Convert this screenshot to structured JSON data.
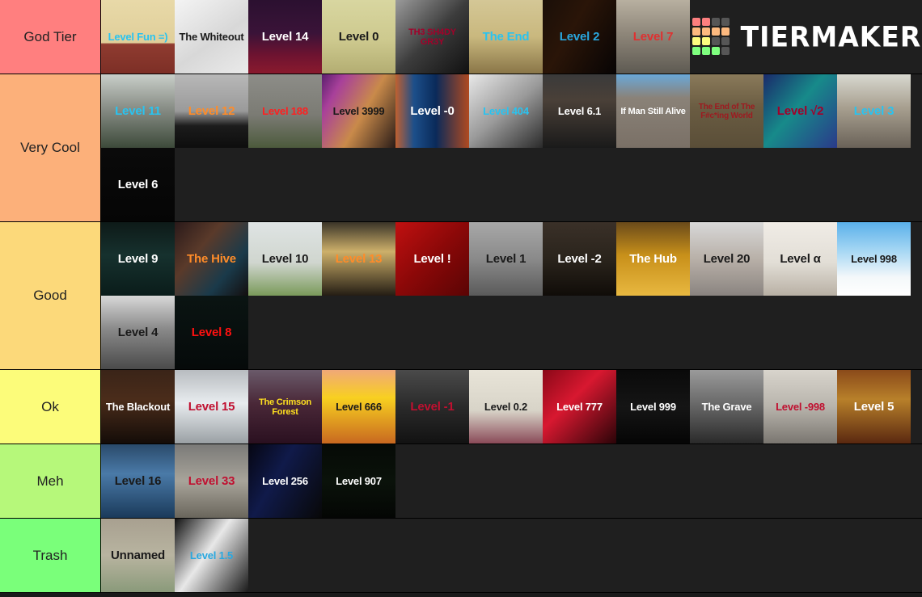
{
  "brand": {
    "name": "TIERMAKER",
    "logo_colors": [
      "#fc7f7f",
      "#fc7f7f",
      "#565656",
      "#565656",
      "#fcb97f",
      "#fcb97f",
      "#fcb97f",
      "#fcb97f",
      "#fcfc7f",
      "#fcfc7f",
      "#565656",
      "#565656",
      "#7fff7f",
      "#7fff7f",
      "#7fff7f",
      "#565656"
    ]
  },
  "tiers": [
    {
      "label": "God Tier",
      "color": "#ff7f7f",
      "items": [
        {
          "label": "Level Fun =)",
          "text_color": "#29c3f0",
          "bg": "linear-gradient(#e8d9a8 0%,#e0cf9a 58%,#8f3b30 60%,#7d2f26 100%)"
        },
        {
          "label": "The Whiteout",
          "text_color": "#1a1a1a",
          "bg": "linear-gradient(145deg,#f4f4f4,#d8d8d8 55%,#eaeaea)"
        },
        {
          "label": "Level 14",
          "text_color": "#ffffff",
          "bg": "linear-gradient(#2b1030 0%,#3a1338 45%,#6e1330 75%,#8a1a2e 100%)"
        },
        {
          "label": "Level 0",
          "text_color": "#1a1a1a",
          "bg": "linear-gradient(#d8d6a0 0%,#cdc98e 55%,#b3ad72 100%)"
        },
        {
          "label": "TH3 SH4DY GR3Y",
          "text_color": "#a3002a",
          "bg": "linear-gradient(135deg,#9a9a9a,#3c3c3c 50%,#111 100%)"
        },
        {
          "label": "The End",
          "text_color": "#29c3f0",
          "bg": "linear-gradient(#d4c796 0%,#c9b87e 50%,#8a7648 100%)"
        },
        {
          "label": "Level 2",
          "text_color": "#29a8e0",
          "bg": "linear-gradient(120deg,#1a0f08,#2a1508 40%,#070404 100%)"
        },
        {
          "label": "Level 7",
          "text_color": "#e03030",
          "bg": "linear-gradient(#b8b0a0 0%,#8f877a 45%,#5e5a52 100%)"
        }
      ]
    },
    {
      "label": "Very Cool",
      "color": "#fcb07a",
      "items": [
        {
          "label": "Level 11",
          "text_color": "#29c3f0",
          "bg": "linear-gradient(#c9cfc9 0%,#8a8f88 45%,#3d4a3a 100%)"
        },
        {
          "label": "Level 12",
          "text_color": "#ff8c29",
          "bg": "linear-gradient(#b8b8b8 0%,#9a9a9a 50%,#1c1c1c 70%,#0d0d0d 100%)"
        },
        {
          "label": "Level 188",
          "text_color": "#ff2020",
          "bg": "linear-gradient(#8d8d88 0%,#7b7b74 55%,#4c5a3c 100%)"
        },
        {
          "label": "Level 3999",
          "text_color": "#1a1a1a",
          "bg": "linear-gradient(120deg,#5b1f6e,#a8409a 20%,#c98a4a 55%,#2a1c18 100%)"
        },
        {
          "label": "Level -0",
          "text_color": "#ffffff",
          "bg": "linear-gradient(90deg,#c06030,#1c4f8a 25%,#0a2a5a 55%,#b04a20 100%)"
        },
        {
          "label": "Level 404",
          "text_color": "#29c3f0",
          "bg": "linear-gradient(140deg,#e8e8e8,#9a9a9a 50%,#2a2a2a)"
        },
        {
          "label": "Level 6.1",
          "text_color": "#ffffff",
          "bg": "linear-gradient(#3a3a3a 0%,#4a4038 35%,#1a1a1a 100%)"
        },
        {
          "label": "If Man Still Alive",
          "text_color": "#ffffff",
          "bg": "linear-gradient(#6aa8d8 0%,#8a8278 32%,#7a7066 100%)"
        },
        {
          "label": "The End of The F#c*ing World",
          "text_color": "#9e1a20",
          "bg": "linear-gradient(#8a7a5a 0%,#6a5c42 45%,#5a4e38 100%)"
        },
        {
          "label": "Level √2",
          "text_color": "#a3002a",
          "bg": "linear-gradient(130deg,#1a2a6a,#178a8a 45%,#2a3a8a 100%)"
        },
        {
          "label": "Level 3",
          "text_color": "#29c3f0",
          "bg": "linear-gradient(#d8d8d0 0%,#a8a090 45%,#6a6258 100%)"
        },
        {
          "label": "Level 6",
          "text_color": "#ffffff",
          "bg": "linear-gradient(#0a0a0a,#050505)"
        }
      ]
    },
    {
      "label": "Good",
      "color": "#fcd97a",
      "items": [
        {
          "label": "Level 9",
          "text_color": "#ffffff",
          "bg": "linear-gradient(#0e1a18 0%,#16312e 45%,#0a1c1a 100%)"
        },
        {
          "label": "The Hive",
          "text_color": "#ff8c29",
          "bg": "linear-gradient(130deg,#2a1a1a,#5a3a2a 35%,#1a3a4a 70%,#140e0e)"
        },
        {
          "label": "Level 10",
          "text_color": "#1a1a1a",
          "bg": "linear-gradient(#dfe4e4 0%,#d0d6cf 55%,#7a9a5a 100%)"
        },
        {
          "label": "Level 13",
          "text_color": "#ff8c29",
          "bg": "linear-gradient(#3a3428 0%,#cdb06a 40%,#241d14 100%)"
        },
        {
          "label": "Level !",
          "text_color": "#ffffff",
          "bg": "linear-gradient(135deg,#c01010,#8a0808 50%,#5a0404)"
        },
        {
          "label": "Level 1",
          "text_color": "#1a1a1a",
          "bg": "linear-gradient(#a8a8a8 0%,#8a8a8a 50%,#5a5a5a 100%)"
        },
        {
          "label": "Level -2",
          "text_color": "#ffffff",
          "bg": "linear-gradient(#3a3028 0%,#2a241c 50%,#100c08 100%)"
        },
        {
          "label": "The Hub",
          "text_color": "#ffffff",
          "bg": "linear-gradient(#6a4a1a 0%,#c8901a 45%,#e8b840 100%)"
        },
        {
          "label": "Level 20",
          "text_color": "#1a1a1a",
          "bg": "linear-gradient(#d8d8d8 0%,#b8b0a8 50%,#8a8480 100%)"
        },
        {
          "label": "Level α",
          "text_color": "#1a1a1a",
          "bg": "linear-gradient(#f0ece6 0%,#e2ded6 55%,#b8b0a4 100%)"
        },
        {
          "label": "Level 998",
          "text_color": "#1a1a1a",
          "bg": "linear-gradient(#5ab0ea 0%,#a8d8f4 40%,#f4f8fa 75%,#ffffff 100%)"
        },
        {
          "label": "Level 4",
          "text_color": "#1a1a1a",
          "bg": "linear-gradient(#d8d8d8 0%,#8a8a8a 45%,#4a4a4a 100%)"
        },
        {
          "label": "Level 8",
          "text_color": "#ff1010",
          "bg": "linear-gradient(#0a1412,#060a0a)"
        }
      ]
    },
    {
      "label": "Ok",
      "color": "#fcfc7a",
      "items": [
        {
          "label": "The Blackout",
          "text_color": "#ffffff",
          "bg": "linear-gradient(#3a2418 0%,#4a2c1a 40%,#140c08 100%)"
        },
        {
          "label": "Level 15",
          "text_color": "#c01030",
          "bg": "linear-gradient(#b8bcc0 0%,#e8ecef 45%,#9aa0a4 100%)"
        },
        {
          "label": "The Crimson Forest",
          "text_color": "#ffe020",
          "bg": "linear-gradient(#6a5a6a 0%,#4a2838 45%,#2a1020 100%)"
        },
        {
          "label": "Level 666",
          "text_color": "#1a1a1a",
          "bg": "linear-gradient(#f0a878 0%,#f8d020 38%,#c86820 100%)"
        },
        {
          "label": "Level -1",
          "text_color": "#c01030",
          "bg": "linear-gradient(#4a4a4a 0%,#2a2a2a 50%,#121212 100%)"
        },
        {
          "label": "Level 0.2",
          "text_color": "#1a1a1a",
          "bg": "linear-gradient(#e8e4d8 0%,#d8d4c8 55%,#8a4a58 100%)"
        },
        {
          "label": "Level 777",
          "text_color": "#ffffff",
          "bg": "linear-gradient(135deg,#8a0818,#d81830 40%,#2a0408 100%)"
        },
        {
          "label": "Level 999",
          "text_color": "#ffffff",
          "bg": "linear-gradient(#0a0a0a,#151515 50%,#050505)"
        },
        {
          "label": "The Grave",
          "text_color": "#ffffff",
          "bg": "linear-gradient(#9a9a9a 0%,#6a6a6a 45%,#2a2a2a 100%)"
        },
        {
          "label": "Level -998",
          "text_color": "#c01030",
          "bg": "linear-gradient(#d8d4cc 0%,#b8b4ac 50%,#7a7670 100%)"
        },
        {
          "label": "Level 5",
          "text_color": "#ffffff",
          "bg": "linear-gradient(#8a4a1a 0%,#b8802a 40%,#5a2810 100%)"
        }
      ]
    },
    {
      "label": "Meh",
      "color": "#b6f87a",
      "items": [
        {
          "label": "Level 16",
          "text_color": "#1a1a1a",
          "bg": "linear-gradient(#2a4a6a 0%,#4a7aa8 40%,#1a3a5a 100%)"
        },
        {
          "label": "Level 33",
          "text_color": "#c01030",
          "bg": "linear-gradient(#7a7a78 0%,#a8a49a 50%,#6a665c 100%)"
        },
        {
          "label": "Level 256",
          "text_color": "#ffffff",
          "bg": "linear-gradient(120deg,#060612,#101a4a 40%,#080808 100%)"
        },
        {
          "label": "Level 907",
          "text_color": "#ffffff",
          "bg": "linear-gradient(#060a06,#0a120a 50%,#040604)"
        }
      ]
    },
    {
      "label": "Trash",
      "color": "#7aff7a",
      "items": [
        {
          "label": "Unnamed",
          "text_color": "#1a1a1a",
          "bg": "linear-gradient(#a8a090 0%,#b8b4a0 50%,#8a9a7a 100%)"
        },
        {
          "label": "Level 1.5",
          "text_color": "#29a8e0",
          "bg": "linear-gradient(125deg,#101010,#e8e8e8 45%,#1a1a1a 100%)"
        }
      ]
    }
  ]
}
